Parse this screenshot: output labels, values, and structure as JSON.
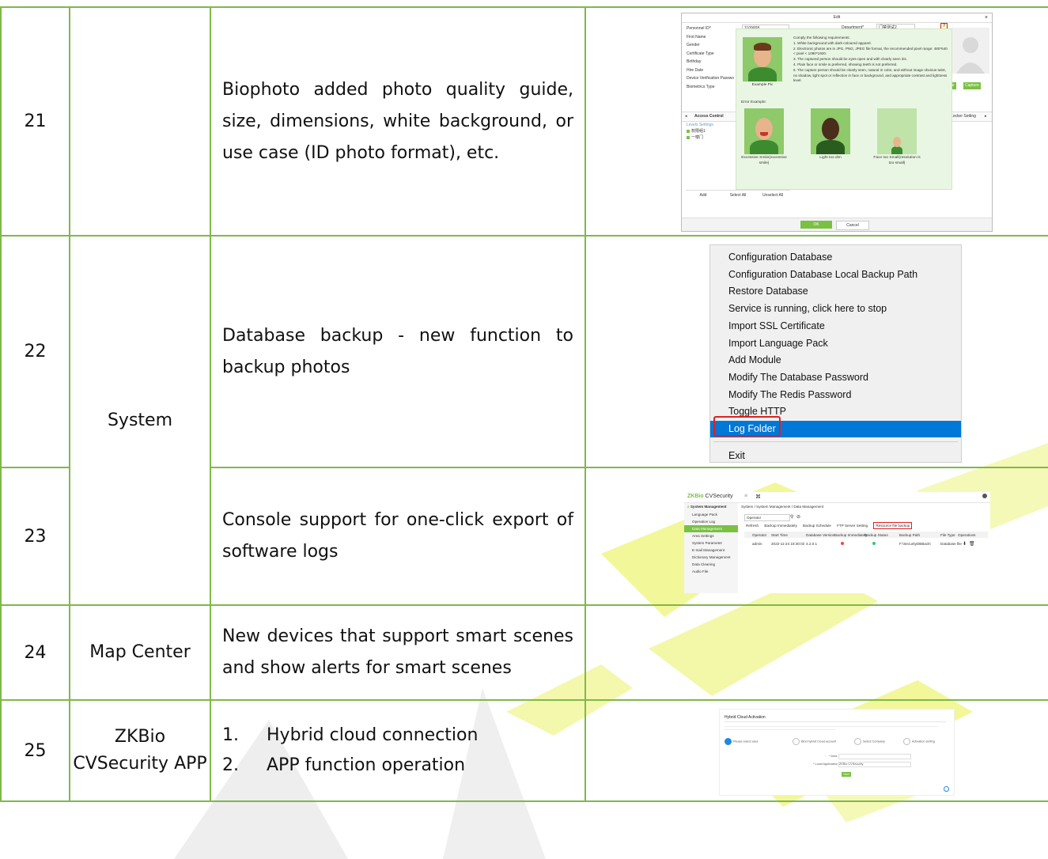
{
  "rows": [
    {
      "no": "21",
      "module": "",
      "description": "Biophoto added photo quality guide, size, dimensions, white background, or use case (ID photo format), etc.",
      "screenshot": {
        "title": "Edit",
        "close": "×",
        "fields": [
          "Personnel ID*",
          "First Name",
          "Gender",
          "Certificate Type",
          "Birthday",
          "Hire Date",
          "Device Verification Passwo",
          "Biometrics Type"
        ],
        "personnel_id_value": "1109008",
        "department_label": "Department*",
        "department_value": "门禁测试2",
        "hint_icon": "?",
        "requirements": [
          "Comply the following requirements:",
          "1. White background with dark-coloured apparel.",
          "2. Electronic photos are in JPG, PNG, JPEG file format, the recommended pixel range: 480*640 < pixel < 1080*1920.",
          "3. The captured person should be eyes-open and with clearly seen iris.",
          "4. Plain face or smile is preferred, showing teeth is not preferred.",
          "5. The capture person should be clearly seen, natural in color, and without image obvious twist, no shadow, light spot or reflection in face or background, and appropriate contrast and lightness level."
        ],
        "example_caption": "Example Pic",
        "error_title": "Error Example:",
        "errors": [
          "Excessive Smile(excessive smile)",
          "Light too dim",
          "Face too Small(resolution is too small)"
        ],
        "tab_left": "Access Control",
        "tab_right": "Locker Setting",
        "levels_label": "Levels Settings",
        "levels": [
          "权限组1",
          "一楼门"
        ],
        "browse_label": "Browse",
        "capture_label": "Capture",
        "bottom_buttons": [
          "Add",
          "Select All",
          "Unselect All"
        ],
        "ok_label": "OK",
        "cancel_label": "Cancel"
      }
    },
    {
      "no": "22",
      "module": "System",
      "description": "Database backup - new function to backup photos",
      "screenshot": {
        "menu_items": [
          "Configuration Database",
          "Configuration Database Local Backup Path",
          "Restore Database",
          "Service is running, click here to stop",
          "Import SSL Certificate",
          "Import Language Pack",
          "Add Module",
          "Modify The Database Password",
          "Modify The Redis Password",
          "Toggle HTTP",
          "Log Folder"
        ],
        "exit_label": "Exit",
        "selected_index": 10
      }
    },
    {
      "no": "23",
      "module": "",
      "description": "Console support for one-click export of software logs",
      "screenshot": {
        "logo_prefix": "ZKBio",
        "logo_suffix": " CVSecurity",
        "menu_header": "System Management",
        "menu_items": [
          "Language Pack",
          "Operation Log",
          "Data Management",
          "Area Settings",
          "System Parameter",
          "E-mail Management",
          "Dictionary Management",
          "Data Cleaning",
          "Audio File"
        ],
        "active_index": 2,
        "breadcrumb": "System / System Management / Data Management",
        "search_placeholder": "Operator",
        "toolbar": [
          "Refresh",
          "Backup Immediately",
          "Backup Schedule",
          "FTP Server Setting",
          "Resource file backup"
        ],
        "columns": [
          "Operator",
          "Start Time",
          "Database Version",
          "Backup Immediately",
          "Backup Status",
          "Backup Path",
          "File Type",
          "Operations"
        ],
        "row": [
          "admin",
          "2022-11-24 18:30:02",
          "4.2.0.1",
          "",
          "",
          "F:\\SecurityDBBack\\",
          "Database file",
          ""
        ]
      }
    },
    {
      "no": "24",
      "module": "Map Center",
      "description": "New devices that support smart scenes and show alerts for smart scenes"
    },
    {
      "no": "25",
      "module": "ZKBio CVSecurity APP",
      "items": [
        {
          "n": "1.",
          "text": "Hybrid cloud connection"
        },
        {
          "n": "2.",
          "text": "APP function operation"
        }
      ],
      "screenshot": {
        "title": "Hybrid Cloud Activation",
        "step1": "Please select area",
        "step2": "Bind hybrid Cloud account",
        "step3": "Select Company",
        "step4": "Activation setting",
        "field1_label": "* Area",
        "field2_label": "* Local Application",
        "field2_value": "ZKBio CVSecurity",
        "next_label": "Next"
      }
    }
  ],
  "colors": {
    "border": "#7fb84a",
    "watermark_yellow": "#f2f79a",
    "watermark_grey": "#e9e9e9",
    "accent_green": "#7ac143",
    "menu_select": "#0078d7",
    "highlight_red": "#e02020"
  }
}
